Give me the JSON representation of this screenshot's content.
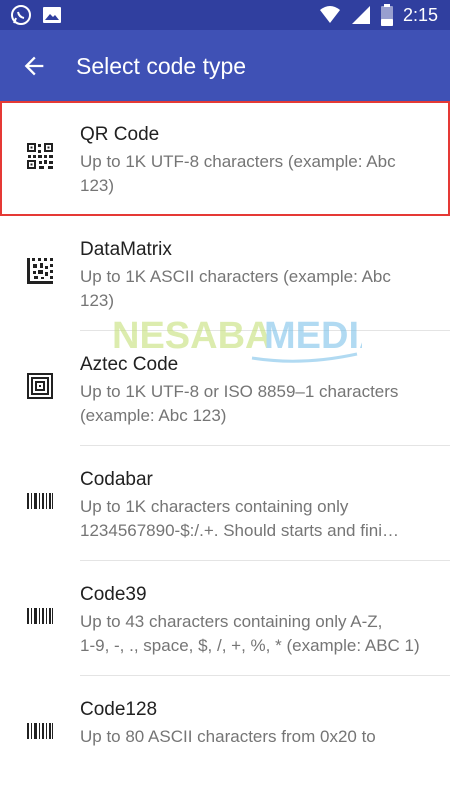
{
  "status_bar": {
    "time": "2:15",
    "left_icons": [
      "whatsapp-icon",
      "image-icon"
    ],
    "right_icons": [
      "wifi-icon",
      "signal-icon",
      "battery-icon"
    ]
  },
  "app_bar": {
    "title": "Select code type",
    "back_icon": "arrow-back-icon",
    "color": "#3f51b5"
  },
  "items": [
    {
      "title": "QR Code",
      "description": "Up to 1K UTF-8 characters (example: Abc\n123)",
      "icon": "qr-code-icon",
      "selected": true
    },
    {
      "title": "DataMatrix",
      "description": "Up to 1K ASCII characters (example: Abc\n123)",
      "icon": "datamatrix-icon"
    },
    {
      "title": "Aztec Code",
      "description": "Up to 1K UTF-8 or ISO 8859–1 characters\n(example: Abc 123)",
      "icon": "aztec-code-icon"
    },
    {
      "title": "Codabar",
      "description": "Up to 1K characters containing only\n1234567890-$:/.+. Should starts and fini…",
      "icon": "barcode-icon"
    },
    {
      "title": "Code39",
      "description": "Up to 43 characters containing only A-Z,\n1-9, -, ., space, $, /, +, %, * (example: ABC 1)",
      "icon": "barcode-icon"
    },
    {
      "title": "Code128",
      "description": "Up to 80 ASCII characters from 0x20 to",
      "icon": "barcode-icon"
    }
  ],
  "watermark": {
    "part1": "NESABA",
    "part2": "MEDIA"
  },
  "colors": {
    "status_bar": "#303f9f",
    "app_bar": "#3f51b5",
    "selection_outline": "#e53935",
    "watermark_green": "#c5e17a",
    "watermark_blue": "#7ec3ea"
  }
}
